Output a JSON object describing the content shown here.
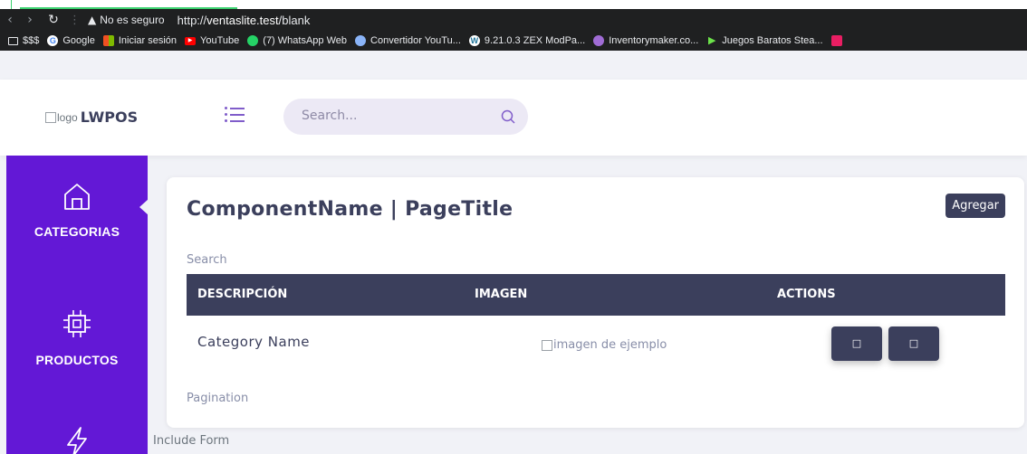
{
  "browser": {
    "warning_text": "No es seguro",
    "url_prefix": "http://",
    "url_host": "ventaslite.test",
    "url_path": "/blank",
    "bookmarks": [
      {
        "label": "$$$",
        "icon": "folder-icon"
      },
      {
        "label": "Google",
        "icon": "google-icon"
      },
      {
        "label": "Iniciar sesión",
        "icon": "microsoft-icon"
      },
      {
        "label": "YouTube",
        "icon": "youtube-icon"
      },
      {
        "label": "(7) WhatsApp Web",
        "icon": "whatsapp-icon"
      },
      {
        "label": "Convertidor YouTu...",
        "icon": "converter-icon"
      },
      {
        "label": "9.21.0.3 ZEX ModPa...",
        "icon": "wordpress-icon"
      },
      {
        "label": "Inventorymaker.co...",
        "icon": "globe-icon"
      },
      {
        "label": "Juegos Baratos Stea...",
        "icon": "play-icon"
      }
    ]
  },
  "header": {
    "logo_alt": "logo",
    "brand": "LWPOS",
    "search_placeholder": "Search..."
  },
  "sidebar": {
    "items": [
      {
        "label": "CATEGORIAS",
        "icon": "home-icon"
      },
      {
        "label": "PRODUCTOS",
        "icon": "chip-icon"
      }
    ]
  },
  "card": {
    "title": "ComponentName | PageTitle",
    "add_label": "Agregar",
    "search_label": "Search",
    "columns": [
      "DESCRIPCIÓN",
      "IMAGEN",
      "ACTIONS"
    ],
    "rows": [
      {
        "name": "Category Name",
        "image_alt": "imagen de ejemplo",
        "action1": "□",
        "action2": "□"
      }
    ],
    "pagination_label": "Pagination"
  },
  "footer": {
    "include_form": "Include Form"
  },
  "colors": {
    "sidebar": "#6318d6",
    "accent": "#805dca",
    "dark": "#3b3f5c"
  }
}
